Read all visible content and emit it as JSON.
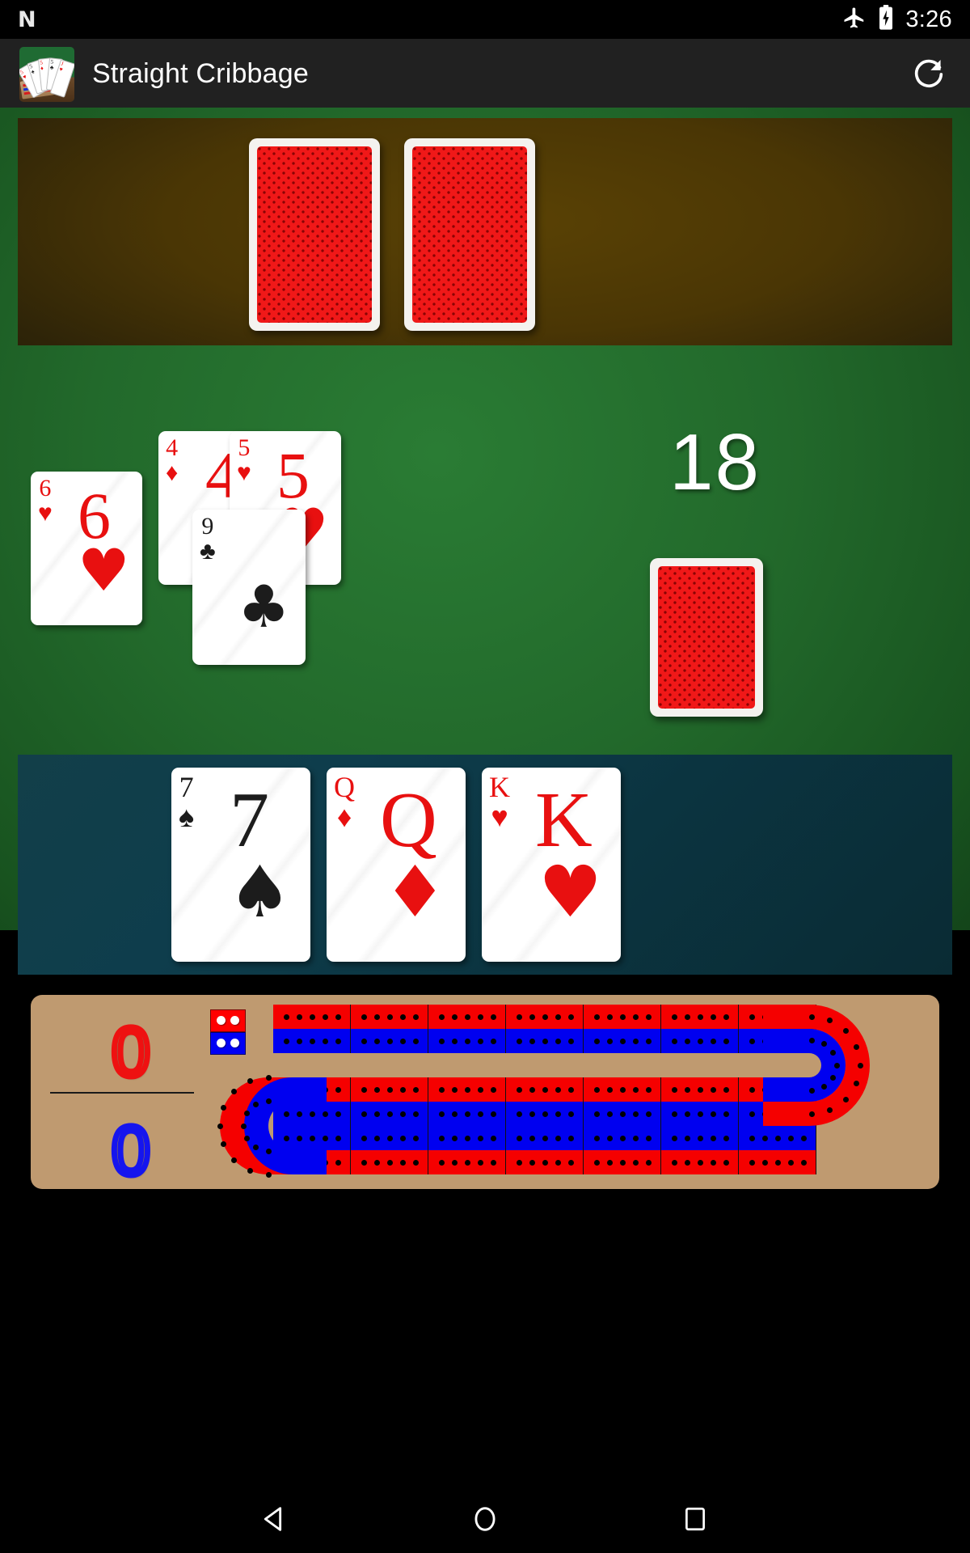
{
  "status_bar": {
    "logo_icon": "android-n-logo-icon",
    "airplane_icon": "airplane-mode-icon",
    "battery_icon": "battery-charging-icon",
    "time": "3:26"
  },
  "action_bar": {
    "app_icon": "app-logo-cards-icon",
    "title": "Straight Cribbage",
    "refresh_icon": "refresh-icon",
    "background": "#212121"
  },
  "crib_area": {
    "name": "crib-area",
    "card_back_count": 2,
    "cards": [
      {
        "facedown": true,
        "label": "face-down-card"
      },
      {
        "facedown": true,
        "label": "face-down-card"
      }
    ]
  },
  "play_area": {
    "name": "pegging-play-area",
    "count": "18",
    "count_label": "running-count",
    "cards": [
      {
        "rank": "6",
        "suit": "hearts",
        "suit_glyph": "♥",
        "color": "red"
      },
      {
        "rank": "4",
        "suit": "diamonds",
        "suit_glyph": "♦",
        "color": "red"
      },
      {
        "rank": "5",
        "suit": "hearts",
        "suit_glyph": "♥",
        "color": "red"
      },
      {
        "rank": "9",
        "suit": "clubs",
        "suit_glyph": "♣",
        "color": "black"
      }
    ],
    "deck": {
      "facedown": true,
      "label": "deck-card-back"
    }
  },
  "hand_area": {
    "name": "player-hand",
    "cards": [
      {
        "rank": "7",
        "suit": "spades",
        "suit_glyph": "♠",
        "color": "black"
      },
      {
        "rank": "Q",
        "suit": "diamonds",
        "suit_glyph": "♦",
        "color": "red"
      },
      {
        "rank": "K",
        "suit": "hearts",
        "suit_glyph": "♥",
        "color": "red"
      }
    ]
  },
  "cribbage_board": {
    "name": "cribbage-board",
    "board_color": "#bf9a70",
    "red_color": "#f50000",
    "blue_color": "#0000f0",
    "score_red": "0",
    "score_blue": "0",
    "holes_per_segment": 5,
    "segments_per_row": 7,
    "start_block": {
      "red_holes": 2,
      "blue_holes": 2
    }
  },
  "nav_bar": {
    "back_icon": "back-triangle-icon",
    "home_icon": "home-circle-icon",
    "recents_icon": "recent-apps-square-icon"
  }
}
